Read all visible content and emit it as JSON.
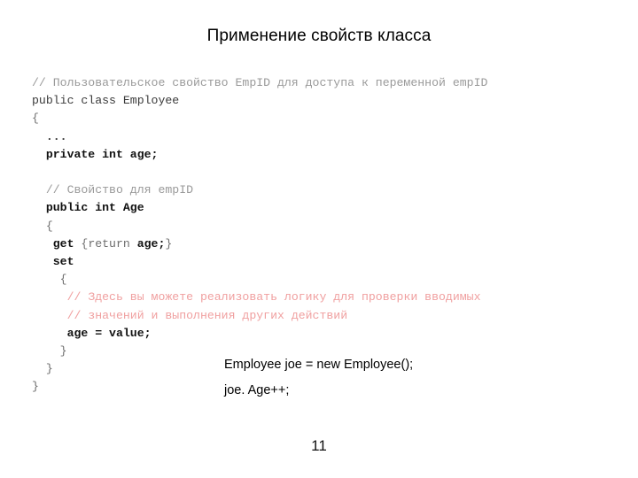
{
  "slide": {
    "title": "Применение свойств класса",
    "page_number": "11"
  },
  "code": {
    "lines": [
      {
        "indent": 0,
        "tokens": [
          {
            "text": "// Пользовательское свойство EmpID для доступа к переменной empID",
            "style": "comment-grey"
          }
        ]
      },
      {
        "indent": 0,
        "tokens": [
          {
            "text": "public class Employee",
            "style": "plain"
          }
        ]
      },
      {
        "indent": 0,
        "tokens": [
          {
            "text": "{",
            "style": "brace"
          }
        ]
      },
      {
        "indent": 1,
        "tokens": [
          {
            "text": "...",
            "style": "dots"
          }
        ]
      },
      {
        "indent": 1,
        "tokens": [
          {
            "text": "private int age;",
            "style": "strong"
          }
        ]
      },
      {
        "indent": 1,
        "tokens": [
          {
            "text": "",
            "style": "plain"
          }
        ]
      },
      {
        "indent": 1,
        "tokens": [
          {
            "text": "// Свойство для empID",
            "style": "comment-grey"
          }
        ]
      },
      {
        "indent": 1,
        "tokens": [
          {
            "text": "public int Age",
            "style": "strong"
          }
        ]
      },
      {
        "indent": 1,
        "tokens": [
          {
            "text": "{",
            "style": "brace"
          }
        ]
      },
      {
        "indent": 1,
        "extra": " ",
        "tokens": [
          {
            "text": "get ",
            "style": "strong"
          },
          {
            "text": "{return ",
            "style": "brace"
          },
          {
            "text": "age;",
            "style": "strong"
          },
          {
            "text": "}",
            "style": "brace"
          }
        ]
      },
      {
        "indent": 1,
        "extra": " ",
        "tokens": [
          {
            "text": "set",
            "style": "strong"
          }
        ]
      },
      {
        "indent": 2,
        "tokens": [
          {
            "text": "{",
            "style": "brace"
          }
        ]
      },
      {
        "indent": 2,
        "extra": " ",
        "tokens": [
          {
            "text": "// Здесь вы можете реализовать логику для проверки вводимых",
            "style": "comment-red"
          }
        ]
      },
      {
        "indent": 2,
        "extra": " ",
        "tokens": [
          {
            "text": "// значений и выполнения других действий",
            "style": "comment-red"
          }
        ]
      },
      {
        "indent": 2,
        "extra": " ",
        "tokens": [
          {
            "text": "age = value;",
            "style": "strong"
          }
        ]
      },
      {
        "indent": 2,
        "tokens": [
          {
            "text": "}",
            "style": "brace"
          }
        ]
      },
      {
        "indent": 1,
        "tokens": [
          {
            "text": "}",
            "style": "brace"
          }
        ]
      },
      {
        "indent": 0,
        "tokens": [
          {
            "text": "}",
            "style": "brace"
          }
        ]
      }
    ]
  },
  "usage": {
    "lines": [
      "Employee joe = new Employee();",
      "joe. Age++;"
    ]
  }
}
